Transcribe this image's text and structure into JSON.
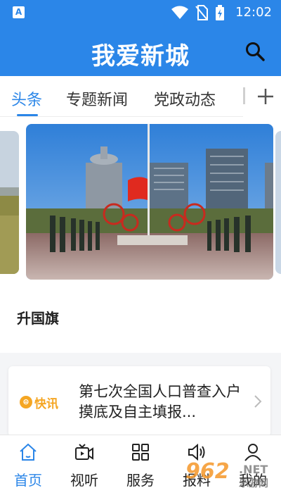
{
  "status_bar": {
    "app_badge": "A",
    "time": "12:02"
  },
  "header": {
    "title": "我爱新城"
  },
  "tabs": [
    {
      "label": "头条",
      "active": true
    },
    {
      "label": "专题新闻",
      "active": false
    },
    {
      "label": "党政动态",
      "active": false
    }
  ],
  "banner": {
    "caption": "升国旗"
  },
  "news": {
    "badge_icon": "⊜",
    "badge_text": "快讯",
    "title": "第七次全国人口普查入户摸底及自主填报..."
  },
  "bottom_nav": [
    {
      "label": "首页",
      "icon": "home-icon",
      "active": true
    },
    {
      "label": "视听",
      "icon": "video-icon",
      "active": false
    },
    {
      "label": "服务",
      "icon": "grid-icon",
      "active": false
    },
    {
      "label": "报料",
      "icon": "speaker-icon",
      "active": false
    },
    {
      "label": "我的",
      "icon": "user-icon",
      "active": false
    }
  ],
  "watermark": {
    "brand": "962",
    "domain": ".NET",
    "site": "乐游网"
  },
  "colors": {
    "accent": "#2b86e8",
    "flash": "#f5a623"
  }
}
